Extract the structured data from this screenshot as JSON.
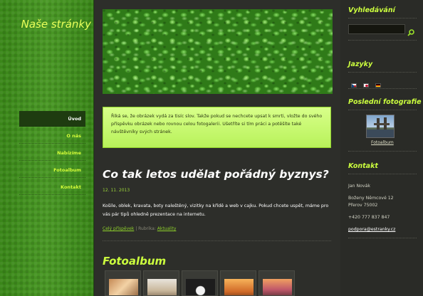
{
  "site": {
    "title": "Naše stránky"
  },
  "nav": {
    "items": [
      {
        "label": "Úvod",
        "active": true
      },
      {
        "label": "O nás",
        "active": false
      },
      {
        "label": "Nabízíme",
        "active": false
      },
      {
        "label": "Fotoalbum",
        "active": false
      },
      {
        "label": "Kontakt",
        "active": false
      }
    ]
  },
  "intro": {
    "text": "Říká se, že obrázek vydá za tisíc slov. Takže pokud se nechcete upsat k smrti, vložte do svého příspěvku obrázek nebo rovnou celou fotogalerii. Ušetříte si tím práci a potěšíte také návštěvníky svých stránek."
  },
  "article": {
    "title": "Co tak letos udělat pořádný byznys?",
    "date": "12. 11. 2013",
    "body": "Košile, oblek, kravata, boty naleštěný, vizitky na křídě a web v cajku. Pokud chcete uspět, máme pro vás pár tipů ohledně prezentace na internetu.",
    "read_more": "Celý příspěvek",
    "separator": " | Rubrika: ",
    "category": "Aktuality"
  },
  "album": {
    "title": "Fotoalbum",
    "thumbs": [
      "thumb-1",
      "thumb-2",
      "thumb-3",
      "thumb-4",
      "thumb-5"
    ]
  },
  "sidebar": {
    "search_heading": "Vyhledávání",
    "search_placeholder": "",
    "languages_heading": "Jazyky",
    "photos_heading": "Poslední fotografie",
    "photo_label": "Fotoalbum",
    "contact_heading": "Kontakt",
    "contact": {
      "name": "Jan Novák",
      "street": "Boženy Němcové 12",
      "city": "Přerov 75002",
      "phone": "+420 777 837 847",
      "email": "podpora@estranky.cz"
    }
  },
  "colors": {
    "accent": "#ccff3e",
    "nav_bg": "#3d8a1c",
    "intro_bg": "#c8f76d"
  },
  "icons": {
    "search": "search-icon"
  }
}
